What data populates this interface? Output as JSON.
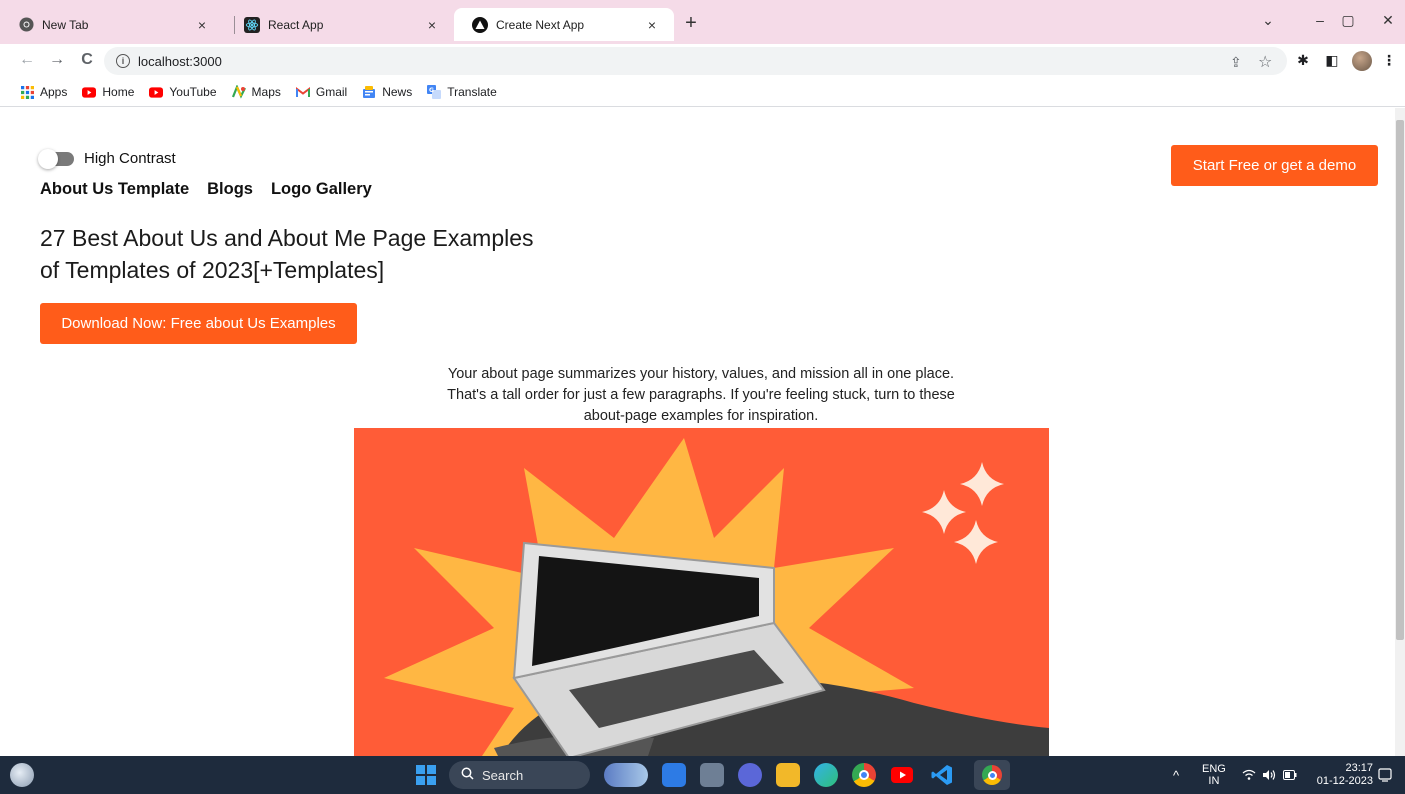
{
  "browser": {
    "tabs": [
      {
        "title": "New Tab",
        "icon": "chrome-icon"
      },
      {
        "title": "React App",
        "icon": "react-icon"
      },
      {
        "title": "Create Next App",
        "icon": "nextjs-icon",
        "active": true
      }
    ],
    "close_glyph": "×",
    "new_tab_glyph": "+",
    "window_controls": {
      "tab_search": "⌄",
      "minimize": "–",
      "restore": "▢",
      "close": "✕"
    },
    "nav": {
      "back": "←",
      "forward": "→",
      "reload": "C"
    },
    "address": {
      "url": "localhost:3000",
      "info_glyph": "i"
    },
    "omnibox_icons": {
      "share": "⇪",
      "bookmark_star": "☆"
    },
    "toolbar_icons": {
      "extensions": "✱",
      "side_panel": "◧",
      "menu": "⋮"
    },
    "bookmarks": [
      {
        "label": "Apps",
        "icon": "apps-grid-icon"
      },
      {
        "label": "Home",
        "icon": "youtube-icon"
      },
      {
        "label": "YouTube",
        "icon": "youtube-icon"
      },
      {
        "label": "Maps",
        "icon": "maps-icon"
      },
      {
        "label": "Gmail",
        "icon": "gmail-icon"
      },
      {
        "label": "News",
        "icon": "news-icon"
      },
      {
        "label": "Translate",
        "icon": "translate-icon"
      }
    ]
  },
  "page": {
    "high_contrast_label": "High Contrast",
    "nav_links": [
      "About Us Template",
      "Blogs",
      "Logo Gallery"
    ],
    "top_cta": "Start Free or get a demo",
    "headline_line1": "27 Best About Us and About Me Page Examples",
    "headline_line2": "of Templates of 2023[+Templates]",
    "download_cta": "Download Now: Free about Us Examples",
    "intro_line1": "Your about page summarizes your history, values, and mission all in one place.",
    "intro_line2": "That's a tall order for just a few paragraphs. If you're feeling stuck, turn to these",
    "intro_line3": "about-page examples for inspiration.",
    "accent_color": "#ff5c1a",
    "hero_bg": "#ff5c37"
  },
  "taskbar": {
    "search_label": "Search",
    "lang_line1": "ENG",
    "lang_line2": "IN",
    "time": "23:17",
    "date": "01-12-2023",
    "tray_chevron": "^"
  }
}
